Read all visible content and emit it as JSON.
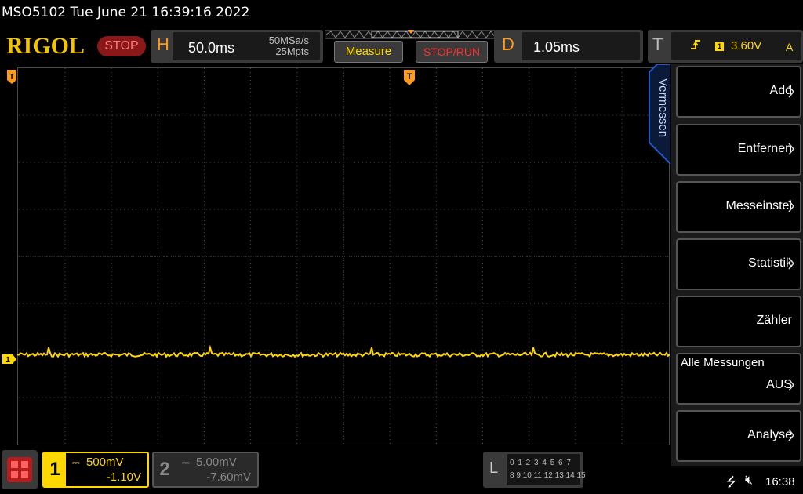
{
  "titlebar": {
    "text": "MSO5102  Tue June 21 16:39:16 2022"
  },
  "logo": {
    "text": "RIGOL"
  },
  "status_button": {
    "label": "STOP"
  },
  "horizontal": {
    "key": "H",
    "timebase": "50.0ms",
    "sample_rate": "50MSa/s",
    "memory_depth": "25Mpts"
  },
  "buttons": {
    "measure": "Measure",
    "stop_run": "STOP/RUN"
  },
  "delay": {
    "key": "D",
    "value": "1.05ms"
  },
  "trigger": {
    "key": "T",
    "edge_icon": "rising-edge-icon",
    "source": "1",
    "level": "3.60V",
    "mode": "A"
  },
  "side_tab": {
    "label": "Vermessen"
  },
  "menu": {
    "items": [
      {
        "label": "Add"
      },
      {
        "label": "Entfernen"
      },
      {
        "label": "Messeinstel"
      },
      {
        "label": "Statistik"
      },
      {
        "label": "Zähler"
      },
      {
        "label": "Alle Messungen",
        "value": "AUS"
      },
      {
        "label": "Analyse"
      }
    ]
  },
  "markers": {
    "ch1": "1",
    "trigger_position": "T"
  },
  "channels": {
    "ch1": {
      "number": "1",
      "scale": "500mV",
      "offset": "-1.10V",
      "color": "#ffd800"
    },
    "ch2": {
      "number": "2",
      "scale": "5.00mV",
      "offset": "-7.60mV",
      "color": "#888888"
    }
  },
  "logic": {
    "key": "L",
    "row1": "0 1 2 3   4 5 6 7",
    "row2": "8 9 10 11 12 13 14 15"
  },
  "statusbar": {
    "time": "16:38",
    "usb_icon": "usb-icon",
    "mute_icon": "speaker-mute-icon"
  },
  "colors": {
    "trace": "#ffd800",
    "accent_orange": "#ff9a1a",
    "stop_red": "#ff3030",
    "menu_border": "#1e5bc6"
  },
  "waveform": {
    "level_fraction_from_top": 0.76,
    "noise": "small spikes"
  }
}
